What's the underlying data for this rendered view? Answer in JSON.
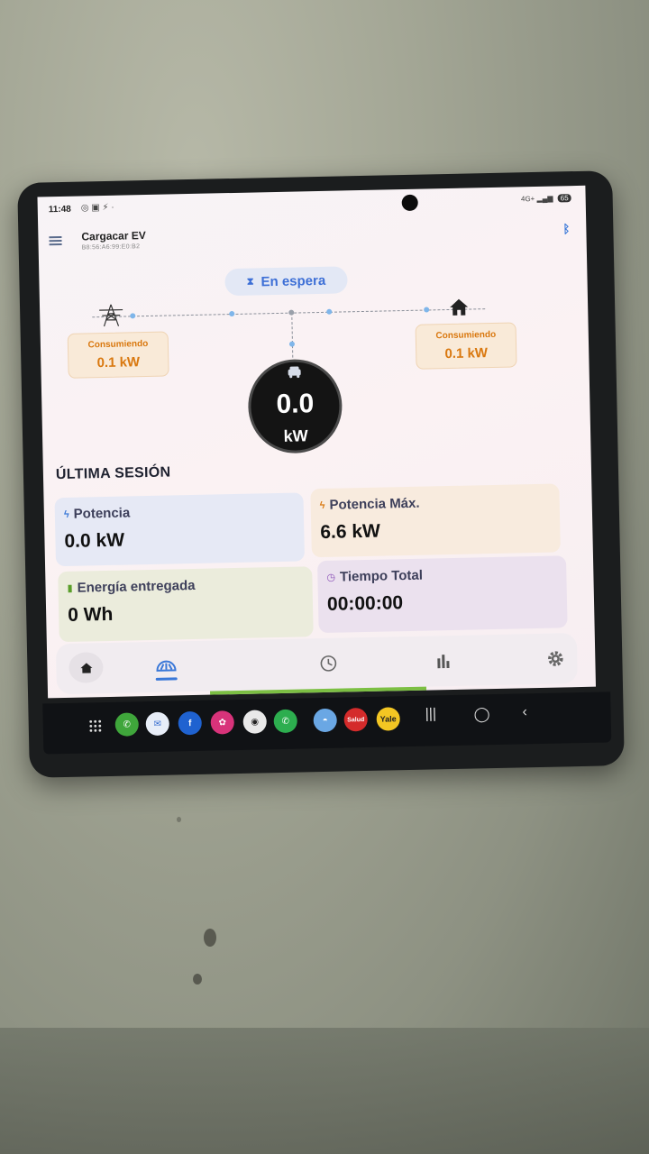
{
  "status_bar": {
    "time": "11:48",
    "network": "4G+",
    "battery": "65"
  },
  "app": {
    "title": "Cargacar EV",
    "device_id": "B8:56:A6:99:E0:B2"
  },
  "charger": {
    "status": "En espera",
    "power_value": "0.0",
    "power_unit": "kW"
  },
  "grid": {
    "label": "Consumiendo",
    "value": "0.1 kW"
  },
  "home": {
    "label": "Consumiendo",
    "value": "0.1 kW"
  },
  "session": {
    "title": "ÚLTIMA SESIÓN",
    "tiles": [
      {
        "label": "Potencia",
        "value": "0.0 kW",
        "icon": "bolt-icon",
        "color": "#e6e9f5"
      },
      {
        "label": "Potencia Máx.",
        "value": "6.6 kW",
        "icon": "bolt-orange-icon",
        "color": "#f8ebde"
      },
      {
        "label": "Energía entregada",
        "value": "0 Wh",
        "icon": "battery-icon",
        "color": "#ebecdc"
      },
      {
        "label": "Tiempo Total",
        "value": "00:00:00",
        "icon": "clock-icon",
        "color": "#ebe1ee"
      }
    ]
  },
  "nav": {
    "items": [
      "home",
      "charger",
      "history",
      "stats",
      "settings"
    ],
    "active": "charger"
  },
  "taskbar": {
    "apps": [
      "phone",
      "email",
      "facebook",
      "gallery",
      "camera",
      "whatsapp",
      "cargacar",
      "recapitsa-salud",
      "yale"
    ],
    "yale_label": "Yale",
    "salud_label": "Salud"
  },
  "colors": {
    "accent": "#3a78d8",
    "orange": "#d9780f",
    "gauge_bg": "#141414"
  }
}
